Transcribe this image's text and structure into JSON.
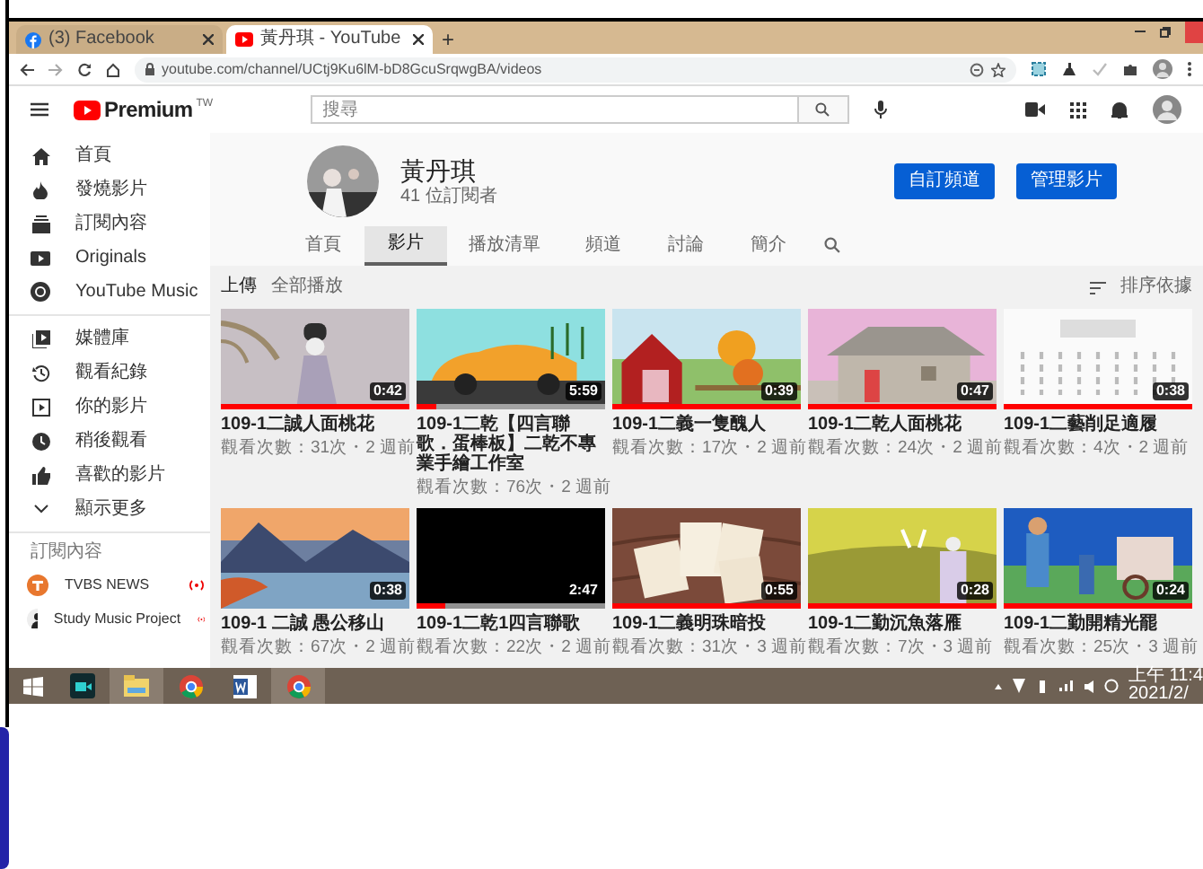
{
  "browser": {
    "tabs": [
      {
        "title": "(3) Facebook",
        "selected": false
      },
      {
        "title": "黃丹琪 - YouTube",
        "selected": true
      }
    ],
    "new_tab": "+",
    "url": "youtube.com/channel/UCtj9Ku6lM-bD8GcuSrqwgBA/videos"
  },
  "header": {
    "logo": "Premium",
    "region": "TW",
    "search": {
      "placeholder": "搜尋"
    }
  },
  "sidebar": {
    "items": [
      {
        "label": "首頁",
        "selected": false
      },
      {
        "label": "發燒影片",
        "selected": false
      },
      {
        "label": "訂閱內容",
        "selected": false
      },
      {
        "label": "Originals",
        "selected": false
      },
      {
        "label": "YouTube Music",
        "selected": false
      }
    ],
    "library": [
      {
        "label": "媒體庫"
      },
      {
        "label": "觀看紀錄"
      },
      {
        "label": "你的影片"
      },
      {
        "label": "稍後觀看"
      },
      {
        "label": "喜歡的影片"
      },
      {
        "label": "顯示更多"
      }
    ],
    "subscriptions_title": "訂閱內容",
    "subscriptions": [
      {
        "label": "TVBS NEWS",
        "live": true
      },
      {
        "label": "Study Music Project",
        "live": true
      }
    ]
  },
  "channel": {
    "name": "黃丹琪",
    "subscribers": "41 位訂閱者",
    "buttons": [
      "自訂頻道",
      "管理影片"
    ],
    "tabs": [
      {
        "label": "首頁",
        "selected": false
      },
      {
        "label": "影片",
        "selected": true
      },
      {
        "label": "播放清單",
        "selected": false
      },
      {
        "label": "頻道",
        "selected": false
      },
      {
        "label": "討論",
        "selected": false
      },
      {
        "label": "簡介",
        "selected": false
      }
    ],
    "section": {
      "title": "上傳",
      "play_all": "全部播放",
      "sort": "排序依據"
    }
  },
  "videos": [
    {
      "title": "109-1二誠人面桃花",
      "duration": "0:42",
      "views": "觀看次數：31次・2 週前",
      "level": 1
    },
    {
      "title": "109-1二乾【四言聯歌．蛋棒板】二乾不專業手繪工作室",
      "duration": "5:59",
      "views": "觀看次數：76次・2 週前",
      "level": 0.1
    },
    {
      "title": "109-1二義一隻醜人",
      "duration": "0:39",
      "views": "觀看次數：17次・2 週前",
      "level": 1
    },
    {
      "title": "109-1二乾人面桃花",
      "duration": "0:47",
      "views": "觀看次數：24次・2 週前",
      "level": 1
    },
    {
      "title": "109-1二藝削足適履",
      "duration": "0:38",
      "views": "觀看次數：4次・2 週前",
      "level": 1
    },
    {
      "title": "109-1 二誠 愚公移山",
      "duration": "0:38",
      "views": "觀看次數：67次・2 週前"
    },
    {
      "title": "109-1二乾1四言聯歌",
      "duration": "2:47",
      "views": "觀看次數：22次・2 週前",
      "level": 0.15
    },
    {
      "title": "109-1二義明珠暗投",
      "duration": "0:55",
      "views": "觀看次數：31次・3 週前",
      "level": 1
    },
    {
      "title": "109-1二勤沉魚落雁",
      "duration": "0:28",
      "views": "觀看次數：7次・3 週前",
      "level": 1
    },
    {
      "title": "109-1二勤開精光罷",
      "duration": "0:24",
      "views": "觀看次數：25次・3 週前",
      "level": 1
    }
  ],
  "taskbar": {
    "time": "上午 11:4",
    "date": "2021/2/"
  }
}
